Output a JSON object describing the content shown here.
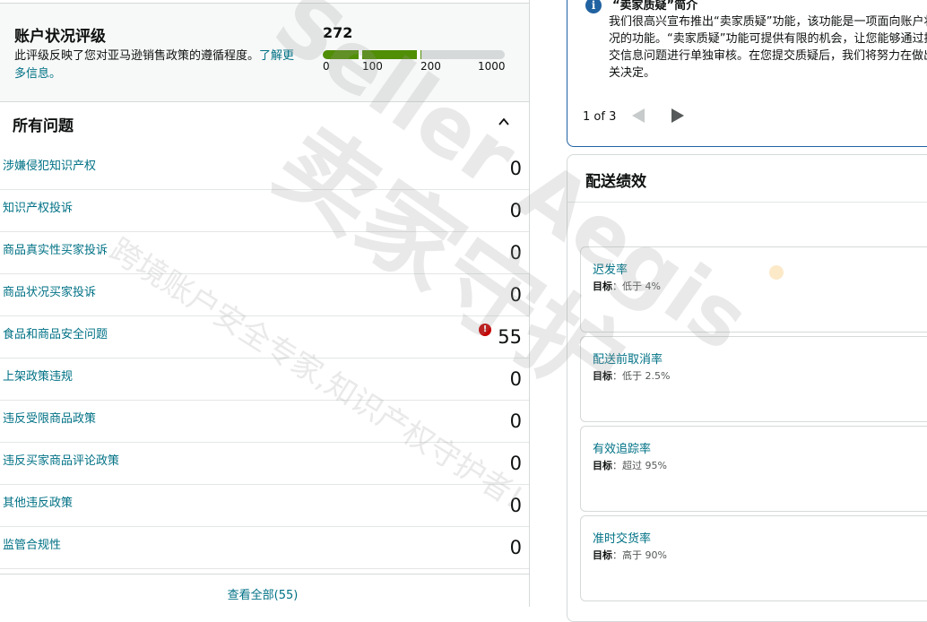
{
  "account_health": {
    "title": "账户状况评级",
    "desc": "此评级反映了您对亚马逊销售政策的遵循程度。",
    "learn_more": "了解更多信息。",
    "score": "272",
    "score_fraction": 0.27,
    "ticks": [
      "0",
      "100",
      "200",
      "1000"
    ],
    "bar_color": "#508e06"
  },
  "issues": {
    "title": "所有问题",
    "rows": [
      {
        "label": "涉嫌侵犯知识产权",
        "value": "0",
        "alert": false
      },
      {
        "label": "知识产权投诉",
        "value": "0",
        "alert": false
      },
      {
        "label": "商品真实性买家投诉",
        "value": "0",
        "alert": false
      },
      {
        "label": "商品状况买家投诉",
        "value": "0",
        "alert": false
      },
      {
        "label": "食品和商品安全问题",
        "value": "55",
        "alert": true
      },
      {
        "label": "上架政策违规",
        "value": "0",
        "alert": false
      },
      {
        "label": "违反受限商品政策",
        "value": "0",
        "alert": false
      },
      {
        "label": "违反买家商品评论政策",
        "value": "0",
        "alert": false
      },
      {
        "label": "其他违反政策",
        "value": "0",
        "alert": false
      },
      {
        "label": "监管合规性",
        "value": "0",
        "alert": false
      }
    ],
    "view_all": "查看全部(55)",
    "alert_icon": "!"
  },
  "notice": {
    "icon": "i",
    "title": "“卖家质疑”简介",
    "body": "我们很高兴宣布推出“卖家质疑”功能，该功能是一项面向账户状况的功能。“卖家质疑”功能可提供有限的机会，让您能够通过提交信息问题进行单独审核。在您提交质疑后，我们将努力在做出关决定。",
    "pager": "1 of 3"
  },
  "delivery": {
    "title": "配送绩效",
    "metrics": [
      {
        "name": "迟发率",
        "target_label": "目标",
        "target_value": "：低于 4%"
      },
      {
        "name": "配送前取消率",
        "target_label": "目标",
        "target_value": "：低于 2.5%"
      },
      {
        "name": "有效追踪率",
        "target_label": "目标",
        "target_value": "：超过 95%"
      },
      {
        "name": "准时交货率",
        "target_label": "目标",
        "target_value": "：高于 90%"
      }
    ]
  },
  "watermark": {
    "line1": "Seller Aegis",
    "line2": "卖家守护",
    "line3": "跨境账户安全专家,知识产权守护者!"
  },
  "colors": {
    "link": "#007185",
    "alert": "#c40000",
    "info": "#2162a1"
  }
}
